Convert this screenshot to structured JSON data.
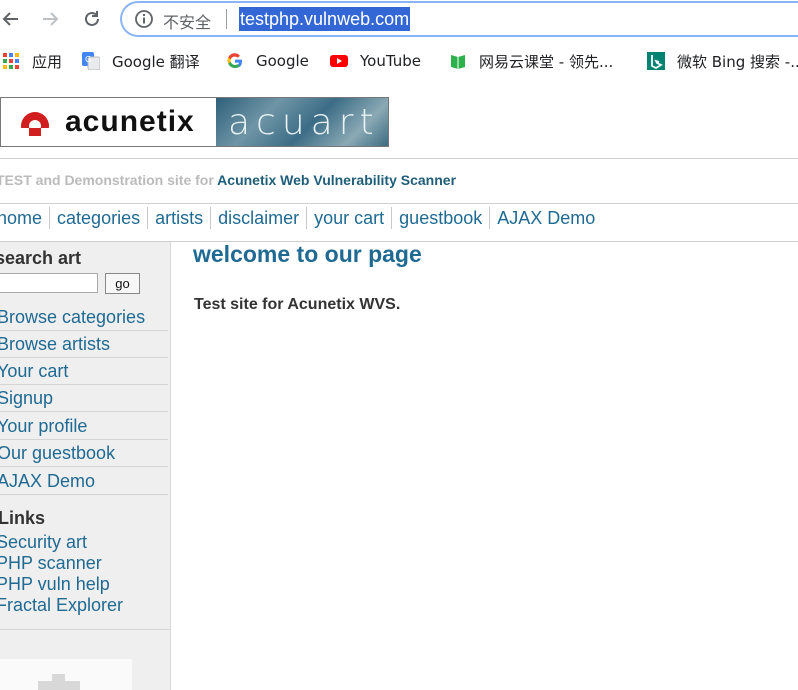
{
  "browser": {
    "security_label": "不安全",
    "url": "testphp.vulnweb.com",
    "bookmarks": [
      {
        "label": "应用",
        "icon": "apps-grid-icon"
      },
      {
        "label": "Google 翻译",
        "icon": "google-translate-icon"
      },
      {
        "label": "Google",
        "icon": "google-icon"
      },
      {
        "label": "YouTube",
        "icon": "youtube-icon"
      },
      {
        "label": "网易云课堂 - 领先...",
        "icon": "netease-study-icon"
      },
      {
        "label": "微软 Bing 搜索 -...",
        "icon": "bing-icon"
      }
    ]
  },
  "site": {
    "logo_left": "acunetix",
    "logo_right": "acuart",
    "tagline_prefix": "TEST and Demonstration site for ",
    "tagline_link": "Acunetix Web Vulnerability Scanner",
    "nav": [
      "home",
      "categories",
      "artists",
      "disclaimer",
      "your cart",
      "guestbook",
      "AJAX Demo"
    ]
  },
  "sidebar": {
    "search_title": "search art",
    "search_value": "",
    "go_label": "go",
    "items": [
      "Browse categories",
      "Browse artists",
      "Your cart",
      "Signup",
      "Your profile",
      "Our guestbook",
      "AJAX Demo"
    ],
    "links_title": "Links",
    "links": [
      "Security art",
      "PHP scanner",
      "PHP vuln help",
      "Fractal Explorer"
    ]
  },
  "main": {
    "heading": "welcome to our page",
    "text": "Test site for Acunetix WVS."
  },
  "colors": {
    "link": "#1f6a93",
    "url_highlight": "#3367d6",
    "sidebar_bg": "#efefef"
  }
}
